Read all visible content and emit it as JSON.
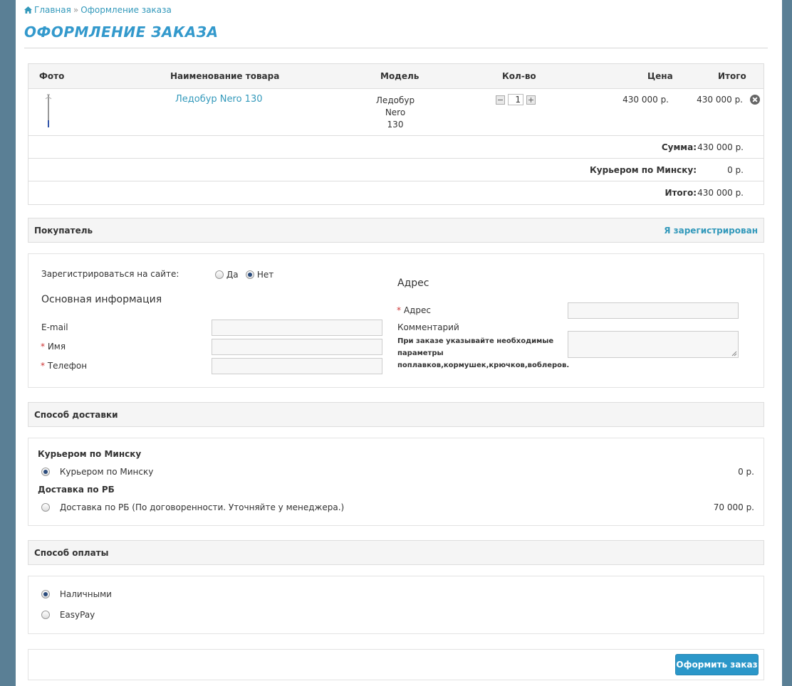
{
  "breadcrumb": {
    "home": "Главная",
    "separator": "»",
    "current": "Оформление заказа"
  },
  "page_title": "ОФОРМЛЕНИЕ ЗАКАЗА",
  "cart": {
    "columns": {
      "photo": "Фото",
      "name": "Наименование товара",
      "model": "Модель",
      "qty": "Кол-во",
      "price": "Цена",
      "total": "Итого"
    },
    "item": {
      "name": "Ледобур Nero 130",
      "model_line1": "Ледобур Nero",
      "model_line2": "130",
      "qty": "1",
      "price": "430 000 р.",
      "total": "430 000 р."
    },
    "totals": [
      {
        "label": "Сумма:",
        "value": "430 000 р."
      },
      {
        "label": "Курьером по Минску:",
        "value": "0 р."
      },
      {
        "label": "Итого:",
        "value": "430 000 р."
      }
    ]
  },
  "buyer": {
    "heading": "Покупатель",
    "login_link": "Я зарегистрирован",
    "register_label": "Зарегистрироваться на сайте:",
    "yes": "Да",
    "no": "Нет",
    "main_info_heading": "Основная информация",
    "email_label": "E-mail",
    "name_label": "Имя",
    "phone_label": "Телефон",
    "required_mark": "*",
    "address_heading": "Адрес",
    "address_label": "Адрес",
    "comment_label": "Комментарий",
    "comment_hint_1": "При заказе указывайте необходимые",
    "comment_hint_2": "параметры",
    "comment_hint_3": "поплавков,кормушек,крючков,воблеров."
  },
  "delivery": {
    "heading": "Способ доставки",
    "groups": [
      {
        "title": "Курьером по Минску",
        "option": "Курьером по Минску",
        "price": "0 р.",
        "selected": true
      },
      {
        "title": "Доставка по РБ",
        "option": "Доставка по РБ (По договоренности. Уточняйте у менеджера.)",
        "price": "70 000 р.",
        "selected": false
      }
    ]
  },
  "payment": {
    "heading": "Способ оплаты",
    "options": [
      {
        "label": "Наличными",
        "selected": true
      },
      {
        "label": "EasyPay",
        "selected": false
      }
    ]
  },
  "submit_label": "Оформить заказ",
  "colors": {
    "accent": "#3399cc",
    "button": "#2b97c9",
    "background": "#5a7f95"
  }
}
